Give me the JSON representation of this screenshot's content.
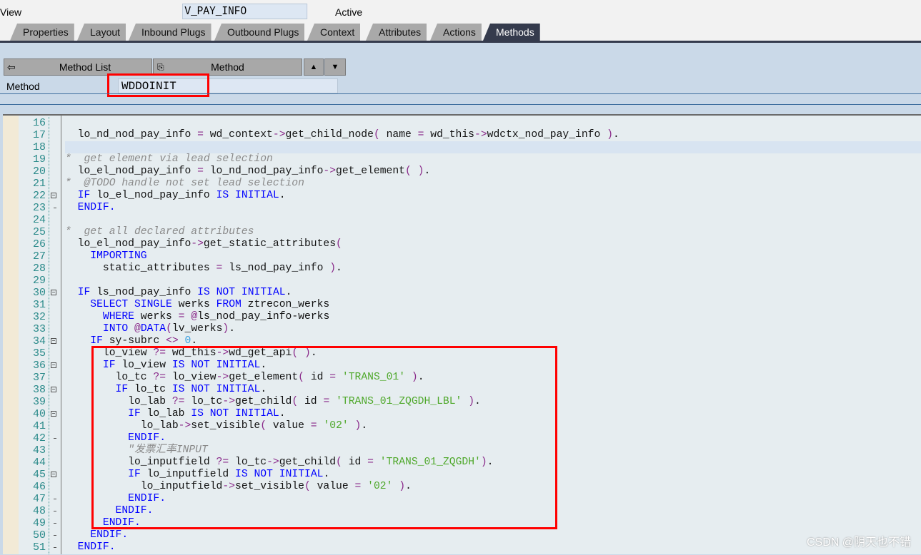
{
  "header": {
    "view_label": "View",
    "view_name": "V_PAY_INFO",
    "status": "Active"
  },
  "tabs": [
    {
      "label": "Properties"
    },
    {
      "label": "Layout"
    },
    {
      "label": "Inbound Plugs"
    },
    {
      "label": "Outbound Plugs"
    },
    {
      "label": "Context"
    },
    {
      "label": "Attributes"
    },
    {
      "label": "Actions"
    },
    {
      "label": "Methods",
      "active": true
    }
  ],
  "toolbar": {
    "method_list_label": "Method List",
    "method_label": "Method",
    "back_icon": "arrow-left-icon",
    "method_icon": "hierarchy-icon",
    "up_icon": "triangle-up-icon",
    "down_icon": "triangle-down-icon"
  },
  "method": {
    "label": "Method",
    "value": "WDDOINIT"
  },
  "editor": {
    "first_line": 16,
    "current_line": 18,
    "lines": [
      "",
      "  lo_nd_nod_pay_info = wd_context->get_child_node( name = wd_this->wdctx_nod_pay_info ).",
      "",
      "*  get element via lead selection",
      "  lo_el_nod_pay_info = lo_nd_nod_pay_info->get_element( ).",
      "*  @TODO handle not set lead selection",
      "  IF lo_el_nod_pay_info IS INITIAL.",
      "  ENDIF.",
      "",
      "*  get all declared attributes",
      "  lo_el_nod_pay_info->get_static_attributes(",
      "    IMPORTING",
      "      static_attributes = ls_nod_pay_info ).",
      "",
      "  IF ls_nod_pay_info IS NOT INITIAL.",
      "    SELECT SINGLE werks FROM ztrecon_werks",
      "      WHERE werks = @ls_nod_pay_info-werks",
      "      INTO @DATA(lv_werks).",
      "    IF sy-subrc <> 0.",
      "      lo_view ?= wd_this->wd_get_api( ).",
      "      IF lo_view IS NOT INITIAL.",
      "        lo_tc ?= lo_view->get_element( id = 'TRANS_01' ).",
      "        IF lo_tc IS NOT INITIAL.",
      "          lo_lab ?= lo_tc->get_child( id = 'TRANS_01_ZQGDH_LBL' ).",
      "          IF lo_lab IS NOT INITIAL.",
      "            lo_lab->set_visible( value = '02' ).",
      "          ENDIF.",
      "          \"发票汇率INPUT",
      "          lo_inputfield ?= lo_tc->get_child( id = 'TRANS_01_ZQGDH').",
      "          IF lo_inputfield IS NOT INITIAL.",
      "            lo_inputfield->set_visible( value = '02' ).",
      "          ENDIF.",
      "        ENDIF.",
      "      ENDIF.",
      "    ENDIF.",
      "  ENDIF."
    ],
    "fold_open": [
      22,
      30,
      34,
      36,
      38,
      40,
      45
    ],
    "fold_end": [
      23,
      42,
      47,
      48,
      49,
      50,
      51
    ]
  },
  "watermark": "CSDN @阴天也不错",
  "colors": {
    "keyword": "#0000ff",
    "string": "#4ea82a",
    "comment": "#8a8a8a",
    "highlight": "#ff0000",
    "active_tab": "#353b4d"
  }
}
